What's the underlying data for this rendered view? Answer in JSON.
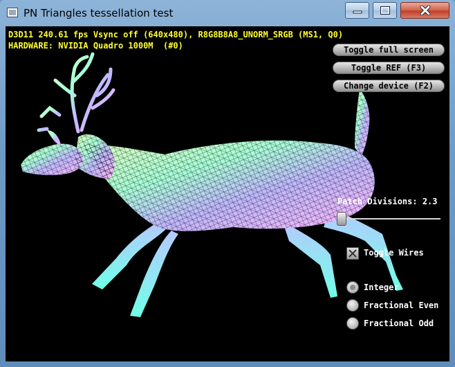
{
  "window": {
    "title": "PN Triangles tessellation test"
  },
  "hud": {
    "line1": "D3D11 240.61 fps Vsync off (640x480), R8G8B8A8_UNORM_SRGB (MS1, Q0)",
    "line2": "HARDWARE: NVIDIA Quadro 1000M  (#0)",
    "color": "#ffff33"
  },
  "buttons": {
    "full_screen": "Toggle full screen",
    "toggle_ref": "Toggle REF (F3)",
    "change_device": "Change device (F2)"
  },
  "slider": {
    "label": "Patch Divisions: 2.3",
    "value": 2.3
  },
  "wires": {
    "label": "Toggle Wires",
    "checked": true
  },
  "partitioning": {
    "options": [
      "Integer",
      "Fractional Even",
      "Fractional Odd"
    ],
    "selected": "Integer"
  },
  "icons": [
    "app-window-icon",
    "minimize-icon",
    "maximize-icon",
    "close-icon"
  ]
}
